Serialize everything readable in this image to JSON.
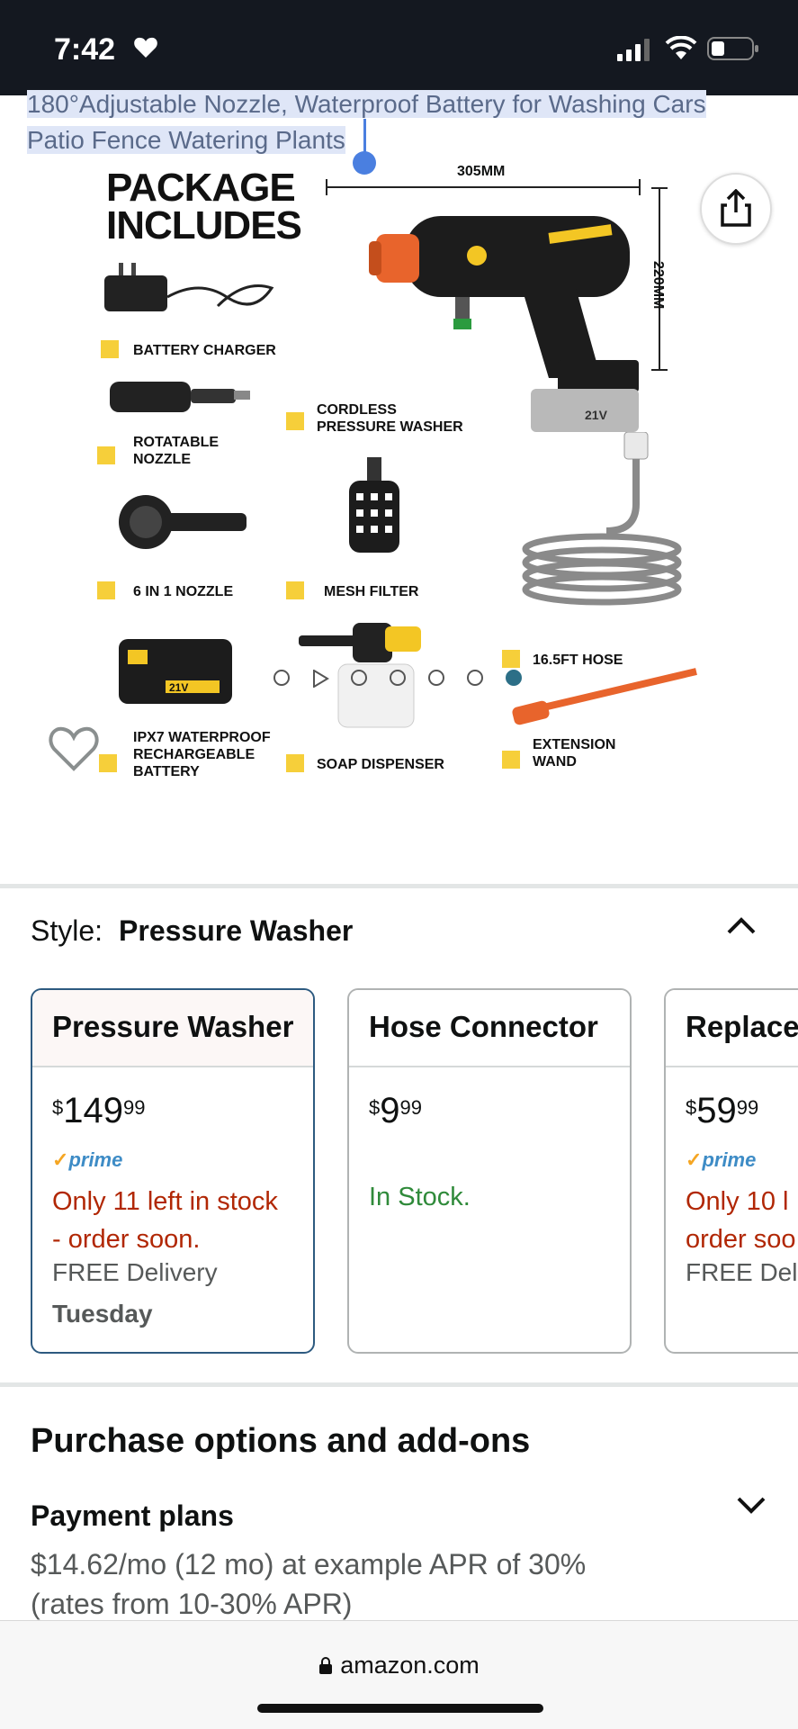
{
  "status_bar": {
    "time": "7:42"
  },
  "title_fragment": {
    "line1": "180°Adjustable Nozzle, Waterproof Battery for Washing Cars",
    "line2": "Patio Fence Watering Plants"
  },
  "product_image": {
    "heading_line1": "PACKAGE",
    "heading_line2": "INCLUDES",
    "width_dim": "305MM",
    "height_dim": "220MM",
    "items": {
      "battery_charger": "BATTERY CHARGER",
      "rotatable_nozzle_1": "ROTATABLE",
      "rotatable_nozzle_2": "NOZZLE",
      "cordless_1": "CORDLESS",
      "cordless_2": "PRESSURE WASHER",
      "nozzle_6in1": "6 IN 1 NOZZLE",
      "mesh_filter": "MESH FILTER",
      "hose": "16.5FT HOSE",
      "battery_1": "IPX7 WATERPROOF",
      "battery_2": "RECHARGEABLE",
      "battery_3": "BATTERY",
      "soap_dispenser": "SOAP DISPENSER",
      "wand_1": "EXTENSION",
      "wand_2": "WAND",
      "battery_voltage": "21V"
    }
  },
  "style": {
    "label": "Style:",
    "value": "Pressure Washer",
    "options": [
      {
        "name": "Pressure Washer",
        "price_sym": "$",
        "price_whole": "149",
        "price_cents": "99",
        "prime": "prime",
        "stock_line1": "Only 11 left in stock",
        "stock_line2": "- order soon.",
        "delivery": "FREE Delivery",
        "delivery_day": "Tuesday"
      },
      {
        "name": "Hose Connector",
        "price_sym": "$",
        "price_whole": "9",
        "price_cents": "99",
        "stock": "In Stock."
      },
      {
        "name": "Replace",
        "price_sym": "$",
        "price_whole": "59",
        "price_cents": "99",
        "prime": "prime",
        "stock_line1": "Only 10 l",
        "stock_line2": "order soo",
        "delivery": "FREE Deli"
      }
    ]
  },
  "purchase_options": {
    "title": "Purchase options and add-ons",
    "payment_title": "Payment plans",
    "payment_text": "$14.62/mo (12 mo) at example APR of 30% (rates from 10-30% APR)"
  },
  "browser": {
    "url": "amazon.com"
  },
  "colors": {
    "prime_blue": "#3e8cc6",
    "stock_red": "#b12704",
    "stock_green": "#2f8a3a",
    "accent_yellow": "#f6cf3a"
  }
}
